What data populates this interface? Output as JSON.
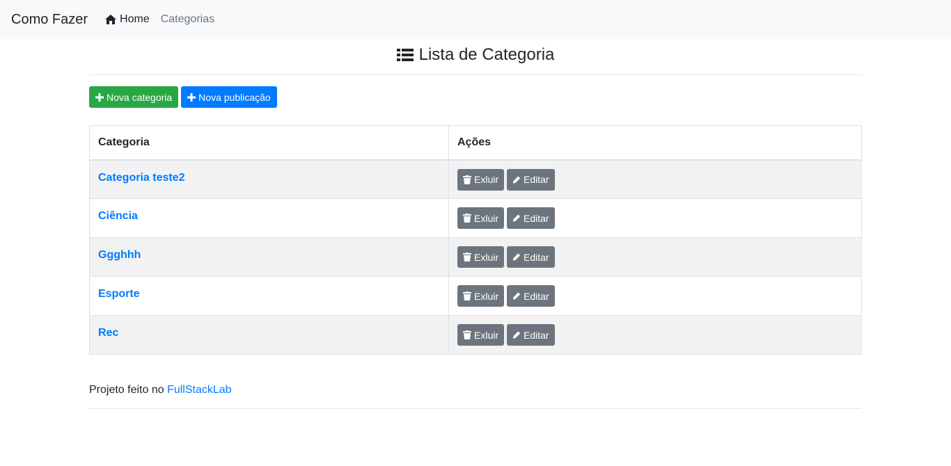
{
  "navbar": {
    "brand": "Como Fazer",
    "home_label": "Home",
    "categories_label": "Categorias"
  },
  "page": {
    "title": "Lista de Categoria"
  },
  "buttons": {
    "new_category": "Nova categoria",
    "new_post": "Nova publicação"
  },
  "table": {
    "headers": [
      "Categoria",
      "Ações"
    ],
    "rows": [
      {
        "name": "Categoria teste2"
      },
      {
        "name": "Ciência"
      },
      {
        "name": "Ggghhh"
      },
      {
        "name": "Esporte"
      },
      {
        "name": "Rec"
      }
    ],
    "delete_label": "Exluir",
    "edit_label": "Editar"
  },
  "footer": {
    "text": "Projeto feito no ",
    "link": "FullStackLab"
  },
  "colors": {
    "success": "#28a745",
    "primary": "#007bff",
    "secondary": "#6c757d"
  }
}
